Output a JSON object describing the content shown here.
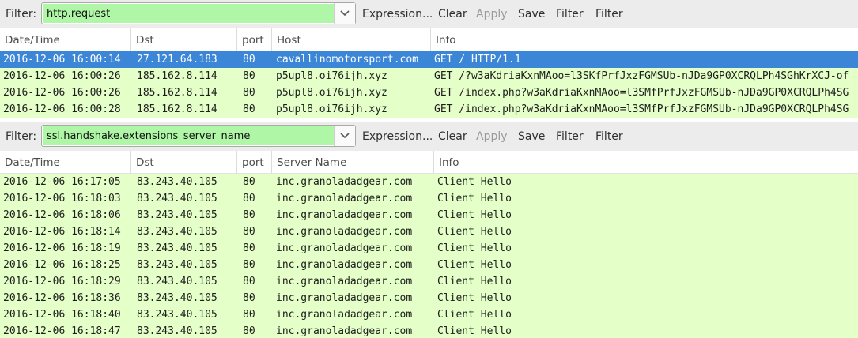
{
  "panels": [
    {
      "filter_label": "Filter:",
      "filter_value": "http.request",
      "toolbar": {
        "expression": "Expression...",
        "clear": "Clear",
        "apply": "Apply",
        "save": "Save",
        "filter1": "Filter",
        "filter2": "Filter"
      },
      "columns": [
        "Date/Time",
        "Dst",
        "port",
        "Host",
        "Info"
      ],
      "rows": [
        [
          "2016-12-06 16:00:14",
          "27.121.64.183",
          "80",
          "cavallinomotorsport.com",
          "GET / HTTP/1.1"
        ],
        [
          "2016-12-06 16:00:26",
          "185.162.8.114",
          "80",
          "p5upl8.oi76ijh.xyz",
          "GET /?w3aKdriaKxnMAoo=l3SKfPrfJxzFGMSUb-nJDa9GP0XCRQLPh4SGhKrXCJ-of"
        ],
        [
          "2016-12-06 16:00:26",
          "185.162.8.114",
          "80",
          "p5upl8.oi76ijh.xyz",
          "GET /index.php?w3aKdriaKxnMAoo=l3SMfPrfJxzFGMSUb-nJDa9GP0XCRQLPh4SG"
        ],
        [
          "2016-12-06 16:00:28",
          "185.162.8.114",
          "80",
          "p5upl8.oi76ijh.xyz",
          "GET /index.php?w3aKdriaKxnMAoo=l3SMfPrfJxzFGMSUb-nJDa9GP0XCRQLPh4SG"
        ]
      ]
    },
    {
      "filter_label": "Filter:",
      "filter_value": "ssl.handshake.extensions_server_name",
      "toolbar": {
        "expression": "Expression...",
        "clear": "Clear",
        "apply": "Apply",
        "save": "Save",
        "filter1": "Filter",
        "filter2": "Filter"
      },
      "columns": [
        "Date/Time",
        "Dst",
        "port",
        "Server Name",
        "Info"
      ],
      "rows": [
        [
          "2016-12-06 16:17:05",
          "83.243.40.105",
          "80",
          "inc.granoladadgear.com",
          "Client Hello"
        ],
        [
          "2016-12-06 16:18:03",
          "83.243.40.105",
          "80",
          "inc.granoladadgear.com",
          "Client Hello"
        ],
        [
          "2016-12-06 16:18:06",
          "83.243.40.105",
          "80",
          "inc.granoladadgear.com",
          "Client Hello"
        ],
        [
          "2016-12-06 16:18:14",
          "83.243.40.105",
          "80",
          "inc.granoladadgear.com",
          "Client Hello"
        ],
        [
          "2016-12-06 16:18:19",
          "83.243.40.105",
          "80",
          "inc.granoladadgear.com",
          "Client Hello"
        ],
        [
          "2016-12-06 16:18:25",
          "83.243.40.105",
          "80",
          "inc.granoladadgear.com",
          "Client Hello"
        ],
        [
          "2016-12-06 16:18:29",
          "83.243.40.105",
          "80",
          "inc.granoladadgear.com",
          "Client Hello"
        ],
        [
          "2016-12-06 16:18:36",
          "83.243.40.105",
          "80",
          "inc.granoladadgear.com",
          "Client Hello"
        ],
        [
          "2016-12-06 16:18:40",
          "83.243.40.105",
          "80",
          "inc.granoladadgear.com",
          "Client Hello"
        ],
        [
          "2016-12-06 16:18:47",
          "83.243.40.105",
          "80",
          "inc.granoladadgear.com",
          "Client Hello"
        ]
      ]
    }
  ],
  "selected_row_panel1": 0,
  "colors": {
    "filter_ok": "#aff7a7",
    "row_bg": "#e4ffc7",
    "row_selected": "#3b86d6"
  },
  "icons": {
    "combo_dropdown": "chevron-down-icon"
  }
}
